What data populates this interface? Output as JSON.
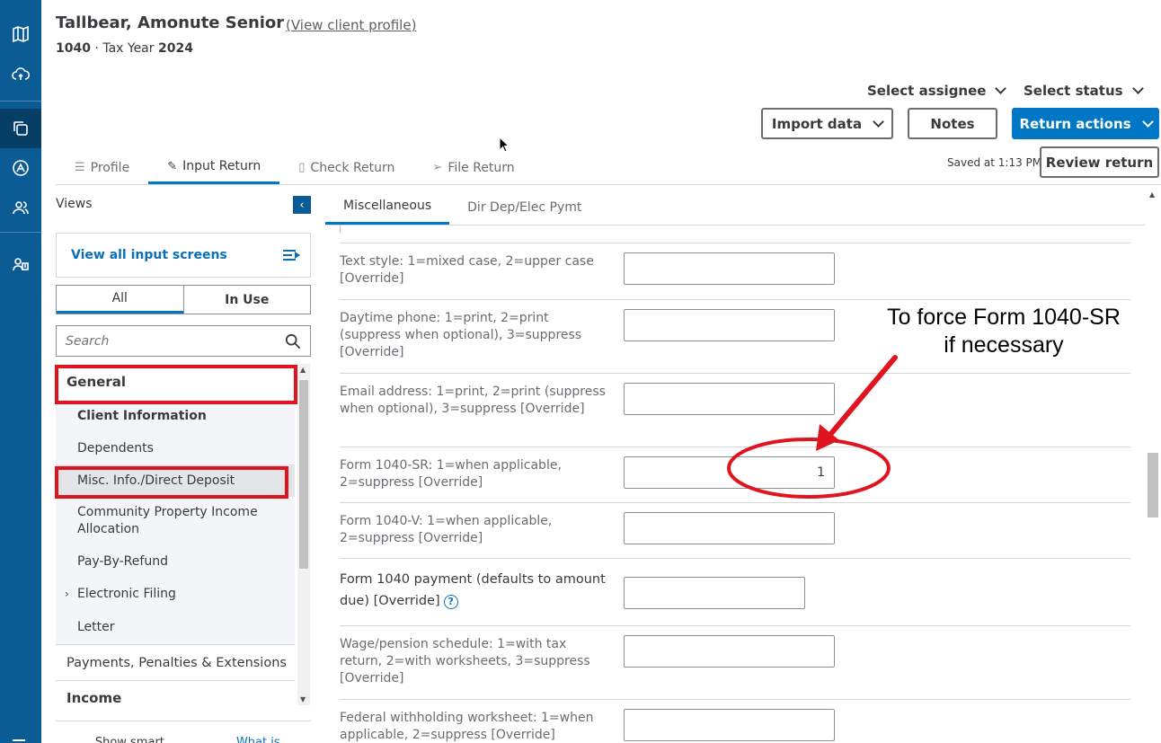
{
  "rail": {
    "icons": [
      "map-icon",
      "cloud-sync-icon",
      "returns-icon",
      "tax-logo-icon",
      "clients-icon",
      "contacts-icon"
    ],
    "active_index": 2
  },
  "header": {
    "client_name": "Tallbear, Amonute Senior",
    "view_profile": "(View client profile)",
    "form": "1040",
    "separator": "·",
    "tax_year_label": "Tax Year",
    "tax_year": "2024",
    "select_assignee": "Select assignee",
    "select_status": "Select status",
    "import_data": "Import data",
    "notes": "Notes",
    "return_actions": "Return actions"
  },
  "tabs": [
    {
      "label": "Profile",
      "icon": "list-icon",
      "active": false
    },
    {
      "label": "Input Return",
      "icon": "pencil-icon",
      "active": true
    },
    {
      "label": "Check Return",
      "icon": "document-icon",
      "active": false
    },
    {
      "label": "File Return",
      "icon": "send-icon",
      "active": false
    }
  ],
  "saved_text": "Saved at 1:13 PM",
  "review_return": "Review return",
  "sidebar": {
    "views_label": "Views",
    "view_all": "View all input screens",
    "segments": [
      "All",
      "In Use"
    ],
    "search_placeholder": "Search",
    "items": [
      {
        "label": "General",
        "type": "head"
      },
      {
        "label": "Client Information",
        "type": "sub-bold"
      },
      {
        "label": "Dependents",
        "type": "sub"
      },
      {
        "label": "Misc. Info./Direct Deposit",
        "type": "sub-selected"
      },
      {
        "label": "Community Property Income Allocation",
        "type": "sub"
      },
      {
        "label": "Pay-By-Refund",
        "type": "sub"
      },
      {
        "label": "Electronic Filing",
        "type": "sub-expand"
      },
      {
        "label": "Letter",
        "type": "sub"
      },
      {
        "label": "Payments, Penalties & Extensions",
        "type": "item"
      },
      {
        "label": "Income",
        "type": "head"
      }
    ],
    "smart_nav_label": "Show smart navigation",
    "smart_nav_link": "What is this?"
  },
  "subtabs": [
    {
      "label": "Miscellaneous",
      "active": true
    },
    {
      "label": "Dir Dep/Elec Pymt",
      "active": false
    }
  ],
  "fields": [
    {
      "label": "Text style: 1=mixed case, 2=upper case [Override]",
      "value": ""
    },
    {
      "label": "Daytime phone: 1=print, 2=print (suppress when optional), 3=suppress [Override]",
      "value": ""
    },
    {
      "label": "Email address: 1=print, 2=print (suppress when optional), 3=suppress [Override]",
      "value": ""
    },
    {
      "label": "Form 1040-SR: 1=when applicable, 2=suppress [Override]",
      "value": "1"
    },
    {
      "label": "Form 1040-V: 1=when applicable, 2=suppress [Override]",
      "value": ""
    },
    {
      "label": "Form 1040 payment (defaults to amount due) [Override]",
      "value": ""
    },
    {
      "label": "Wage/pension schedule: 1=with tax return, 2=with worksheets, 3=suppress [Override]",
      "value": ""
    },
    {
      "label": "Federal withholding worksheet: 1=when applicable, 2=suppress [Override]",
      "value": ""
    }
  ],
  "annotation": {
    "text": "To force Form 1040-SR if necessary",
    "color": "#e0141e"
  },
  "colors": {
    "brand": "#0b5b94",
    "accent": "#0077c5",
    "highlight": "#e0141e"
  }
}
